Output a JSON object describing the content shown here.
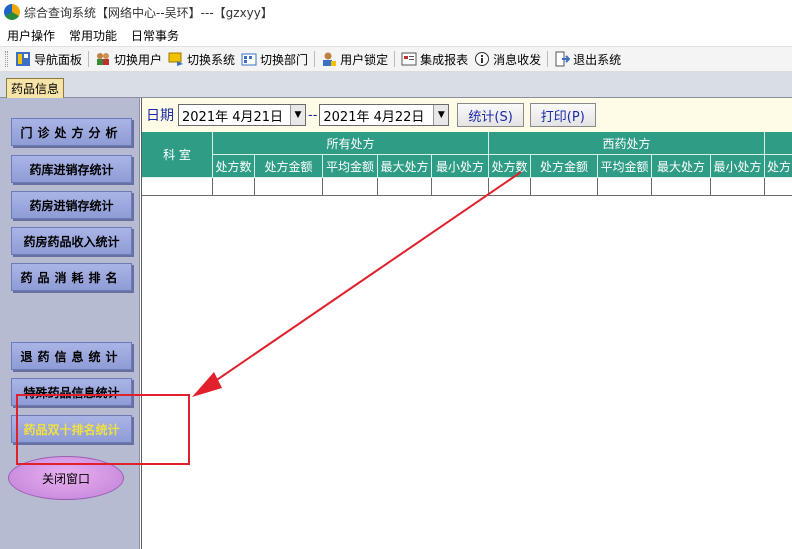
{
  "window": {
    "title": "综合查询系统【网络中心--吴环】---【gzxyy】"
  },
  "menu": [
    "用户操作",
    "常用功能",
    "日常事务"
  ],
  "toolbar": [
    {
      "label": "导航面板",
      "icon": "navigation-panel-icon"
    },
    {
      "label": "切换用户",
      "icon": "switch-user-icon"
    },
    {
      "label": "切换系统",
      "icon": "switch-system-icon"
    },
    {
      "label": "切换部门",
      "icon": "switch-department-icon"
    },
    {
      "label": "用户锁定",
      "icon": "user-lock-icon"
    },
    {
      "label": "集成报表",
      "icon": "report-icon"
    },
    {
      "label": "消息收发",
      "icon": "message-icon"
    },
    {
      "label": "退出系统",
      "icon": "exit-icon"
    }
  ],
  "tab": {
    "label": "药品信息"
  },
  "sidebar": {
    "buttons": [
      "门诊处方分析",
      "药库进销存统计",
      "药房进销存统计",
      "药房药品收入统计",
      "药品消耗排名",
      "退药信息统计",
      "特殊药品信息统计",
      "药品双十排名统计"
    ],
    "close": "关闭窗口"
  },
  "filter": {
    "label": "日期",
    "start_date": "2021年 4月21日",
    "separator": "--",
    "end_date": "2021年 4月22日",
    "stat_button": "统计(S)",
    "print_button": "打印(P)"
  },
  "grid": {
    "dept_header": "科 室",
    "groups": [
      "所有处方",
      "西药处方",
      ""
    ],
    "columns": [
      "处方数",
      "处方金额",
      "平均金额",
      "最大处方",
      "最小处方",
      "处方数",
      "处方金额",
      "平均金额",
      "最大处方",
      "最小处方",
      "处方"
    ]
  },
  "colors": {
    "header_bg": "#2f9d86",
    "annotation": "#e0202a",
    "filter_text": "#1a2aa8"
  }
}
